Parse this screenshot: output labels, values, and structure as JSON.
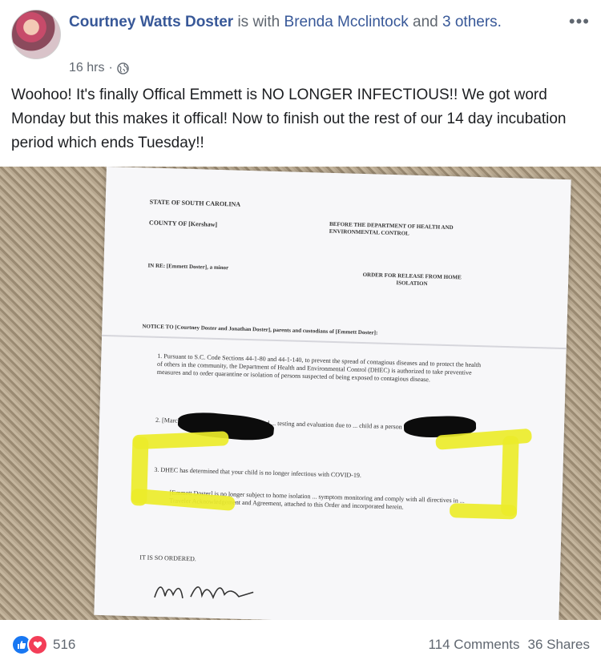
{
  "post": {
    "author": "Courtney Watts Doster",
    "with_text": "is with",
    "tagged": "Brenda Mcclintock",
    "and_text": "and",
    "others": "3 others.",
    "time": "16 hrs",
    "separator": "·",
    "privacy_icon": "globe-icon",
    "more_icon": "more-options-icon",
    "text": "Woohoo! It's finally Offical Emmett is NO LONGER INFECTIOUS!! We got word Monday but this makes it offical! Now to finish out the rest of our 14 day incubation period which ends Tuesday!!"
  },
  "document": {
    "state_line": "STATE OF SOUTH CAROLINA",
    "county_line": "COUNTY OF [Kershaw]",
    "dept_line": "BEFORE THE DEPARTMENT OF HEALTH AND ENVIRONMENTAL CONTROL",
    "in_re": "IN RE: [Emmett Doster], a minor",
    "order_title": "ORDER FOR RELEASE FROM HOME ISOLATION",
    "notice": "NOTICE TO [Courtney Doster and Jonathan Doster], parents and custodians of [Emmett Doster]:",
    "para1": "1. Pursuant to S.C. Code Sections 44-1-80 and 44-1-140, to prevent the spread of contagious diseases and to protect the health of others in the community, the Department of Health and Environmental Control (DHEC) is authorized to take preventive measures and to order quarantine or isolation of persons suspected of being exposed to contagious disease.",
    "para2": "2. [March 18, 2020], your child was isolated ... testing and evaluation due to ... child as a person under investigation ... WID",
    "para3": "3. DHEC has determined that your child is no longer infectious with COVID-19.",
    "para4": "[Emmett Doster] is no longer subject to home isolation ... symptom monitoring and comply with all directives in ... Traveler Acknowledgement and Agreement, attached to this Order and incorporated herein.",
    "ordered": "IT IS SO ORDERED.",
    "signature": "Hugh Hill"
  },
  "footer": {
    "like_icon": "like-icon",
    "love_icon": "love-icon",
    "reaction_count": "516",
    "comments": "114 Comments",
    "shares": "36 Shares"
  },
  "colors": {
    "link": "#385898",
    "meta": "#606770",
    "like": "#1877f2",
    "love": "#f33e58",
    "highlight": "#ecec2a"
  }
}
